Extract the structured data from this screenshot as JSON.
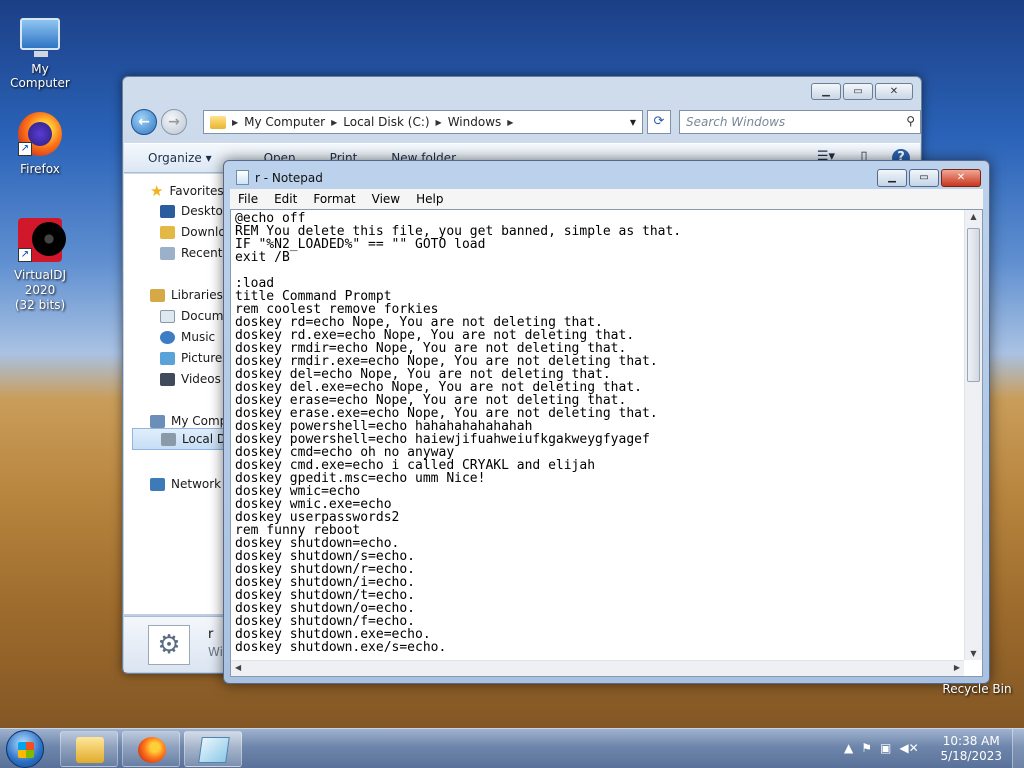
{
  "desktop": {
    "icons": [
      {
        "label": "My Computer",
        "icon": "computer-icon"
      },
      {
        "label": "Firefox",
        "icon": "firefox-icon"
      },
      {
        "label": "VirtualDJ 2020\n(32 bits)",
        "icon": "virtualdj-icon"
      }
    ],
    "recycle_bin": "Recycle Bin"
  },
  "explorer": {
    "address": {
      "parts": [
        "My Computer",
        "Local Disk (C:)",
        "Windows"
      ]
    },
    "search_placeholder": "Search Windows",
    "toolbar": {
      "organize": "Organize ▾",
      "open": "Open",
      "print": "Print",
      "new_folder": "New folder"
    },
    "nav": {
      "favorites": "Favorites",
      "desktop": "Desktop",
      "downloads": "Downlo",
      "recent": "Recent P",
      "libraries": "Libraries",
      "documents": "Docume",
      "music": "Music",
      "pictures": "Pictures",
      "videos": "Videos",
      "my_computer": "My Comp",
      "local_disk": "Local Di",
      "network": "Network"
    },
    "details": {
      "name": "r",
      "type": "Wi"
    }
  },
  "notepad": {
    "title": "r - Notepad",
    "menu": [
      "File",
      "Edit",
      "Format",
      "View",
      "Help"
    ],
    "content": "@echo off\nREM You delete this file, you get banned, simple as that.\nIF \"%N2_LOADED%\" == \"\" GOTO load\nexit /B\n\n:load\ntitle Command Prompt\nrem coolest remove forkies\ndoskey rd=echo Nope, You are not deleting that.\ndoskey rd.exe=echo Nope, You are not deleting that.\ndoskey rmdir=echo Nope, You are not deleting that.\ndoskey rmdir.exe=echo Nope, You are not deleting that.\ndoskey del=echo Nope, You are not deleting that.\ndoskey del.exe=echo Nope, You are not deleting that.\ndoskey erase=echo Nope, You are not deleting that.\ndoskey erase.exe=echo Nope, You are not deleting that.\ndoskey powershell=echo hahahahahahahah\ndoskey powershell=echo haiewjifuahweiufkgakweygfyagef\ndoskey cmd=echo oh no anyway\ndoskey cmd.exe=echo i called CRYAKL and elijah\ndoskey gpedit.msc=echo umm Nice!\ndoskey wmic=echo\ndoskey wmic.exe=echo\ndoskey userpasswords2\nrem funny reboot\ndoskey shutdown=echo.\ndoskey shutdown/s=echo.\ndoskey shutdown/r=echo.\ndoskey shutdown/i=echo.\ndoskey shutdown/t=echo.\ndoskey shutdown/o=echo.\ndoskey shutdown/f=echo.\ndoskey shutdown.exe=echo.\ndoskey shutdown.exe/s=echo."
  },
  "taskbar": {
    "clock_time": "10:38 AM",
    "clock_date": "5/18/2023"
  }
}
